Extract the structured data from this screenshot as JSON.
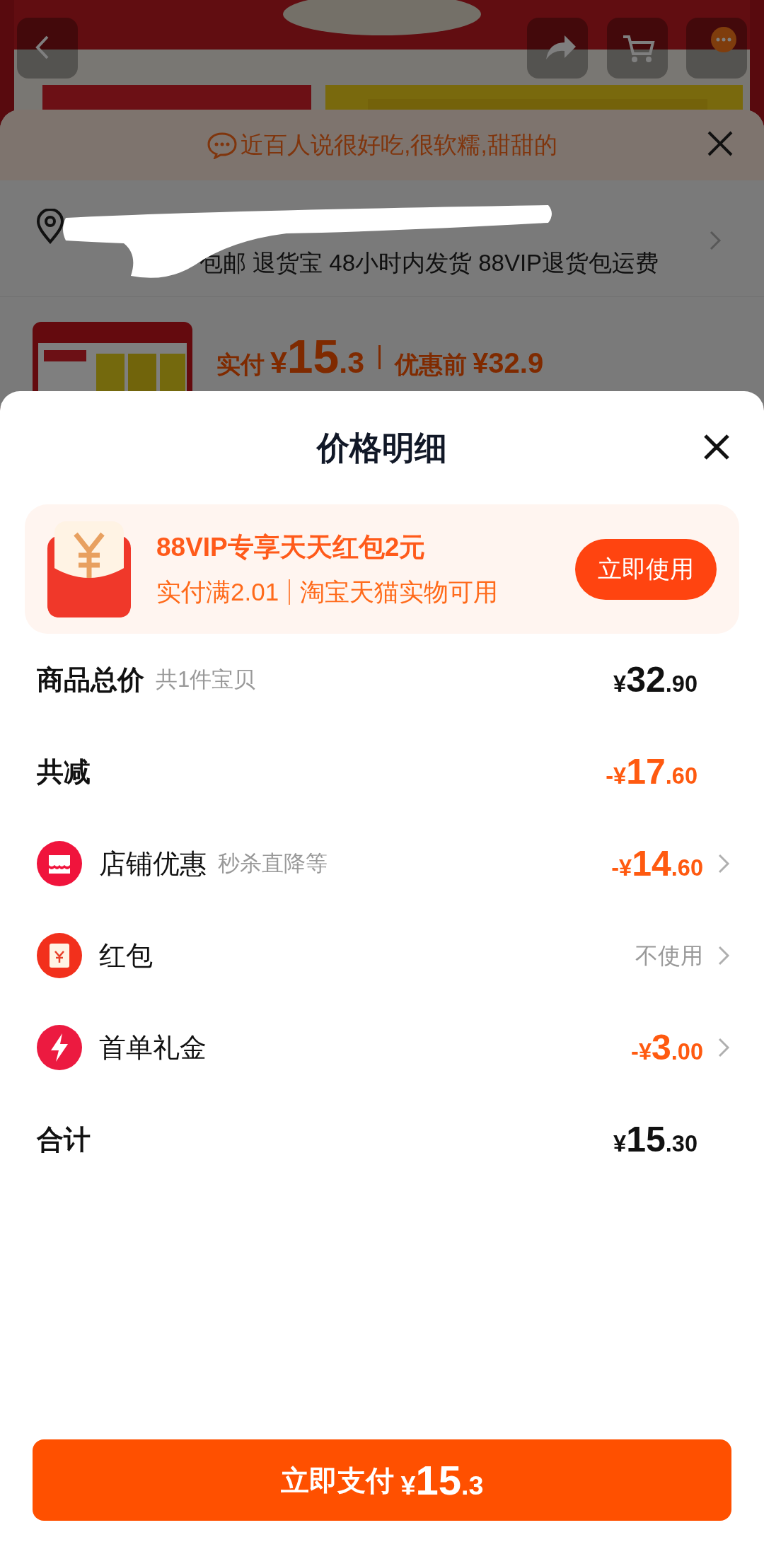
{
  "background": {
    "review_banner": "近百人说很好吃,很软糯,甜甜的",
    "address": {
      "service_line": "包邮 退货宝 48小时内发货 88VIP退货包运费"
    },
    "product": {
      "kind": "picture",
      "paid_label": "实付",
      "paid_amount": {
        "prefix": "¥",
        "main": "15",
        "fraction": ".3"
      },
      "original_label": "优惠前",
      "original_price": "¥32.9"
    }
  },
  "sheet": {
    "title": "价格明细",
    "promo": {
      "title": "88VIP专享天天红包2元",
      "conditions": [
        "实付满2.01",
        "淘宝天猫实物可用"
      ],
      "button": "立即使用"
    },
    "rows": [
      {
        "kind": "summary",
        "label": "商品总价",
        "note": "共1件宝贝",
        "amount": {
          "prefix": "¥",
          "main": "32",
          "fraction": ".90"
        }
      },
      {
        "kind": "reduction",
        "label": "共减",
        "amount": {
          "prefix": "-¥",
          "main": "17",
          "fraction": ".60"
        }
      },
      {
        "kind": "discount",
        "label": "店铺优惠",
        "note": "秒杀直降等",
        "amount": {
          "prefix": "-¥",
          "main": "14",
          "fraction": ".60"
        }
      },
      {
        "kind": "unused",
        "label": "红包",
        "value": "不使用"
      },
      {
        "kind": "discount",
        "label": "首单礼金",
        "amount": {
          "prefix": "-¥",
          "main": "3",
          "fraction": ".00"
        }
      },
      {
        "kind": "summary",
        "label": "合计",
        "amount": {
          "prefix": "¥",
          "main": "15",
          "fraction": ".30"
        }
      }
    ],
    "pay_button": {
      "label": "立即支付",
      "amount": {
        "prefix": "¥",
        "main": "15",
        "fraction": ".3"
      }
    }
  }
}
